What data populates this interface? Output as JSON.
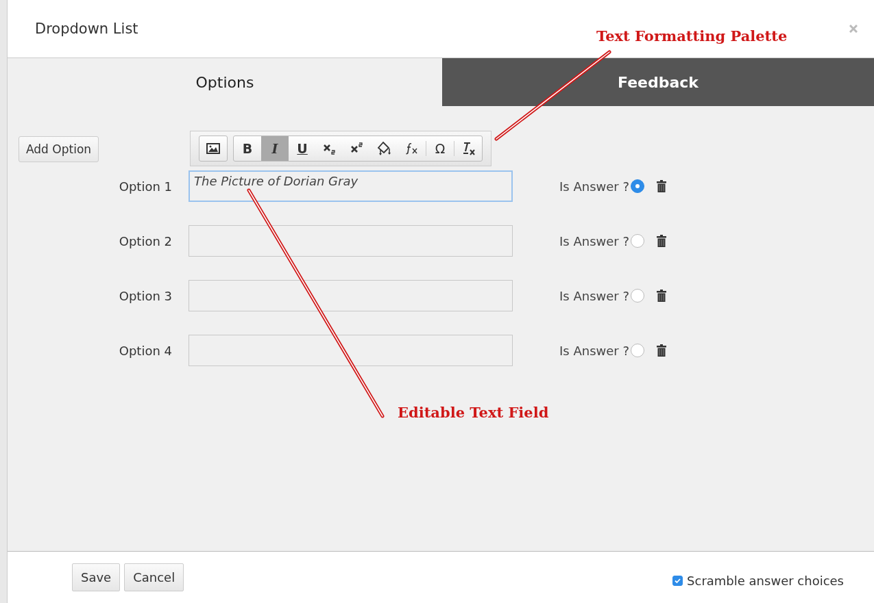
{
  "dialog": {
    "title": "Dropdown List"
  },
  "tabs": [
    {
      "label": "Options",
      "selected": true
    },
    {
      "label": "Feedback",
      "selected": false
    }
  ],
  "add_option_button": "Add Option",
  "toolbar": [
    {
      "kind": "image",
      "pressed": false
    },
    {
      "kind": "bold",
      "label": "B",
      "pressed": false
    },
    {
      "kind": "italic",
      "label": "I",
      "pressed": true
    },
    {
      "kind": "underline",
      "label": "U",
      "pressed": false
    },
    {
      "kind": "subscript",
      "pressed": false
    },
    {
      "kind": "superscript",
      "pressed": false
    },
    {
      "kind": "fill",
      "pressed": false
    },
    {
      "kind": "formula",
      "pressed": false
    },
    {
      "kind": "symbol",
      "label": "Ω",
      "pressed": false
    },
    {
      "kind": "clear",
      "pressed": false
    }
  ],
  "options": [
    {
      "label": "Option 1",
      "value": "The Picture of Dorian Gray",
      "focused": true,
      "answer_label": "Is Answer ?",
      "is_answer": true
    },
    {
      "label": "Option 2",
      "focused": false,
      "answer_label": "Is Answer ?",
      "is_answer": false
    },
    {
      "label": "Option 3",
      "focused": false,
      "answer_label": "Is Answer ?",
      "is_answer": false
    },
    {
      "label": "Option 4",
      "focused": false,
      "answer_label": "Is Answer ?",
      "is_answer": false
    }
  ],
  "footer": {
    "buttons": [
      "Save",
      "Cancel"
    ],
    "scramble": {
      "label": "Scramble answer choices",
      "checked": true
    }
  },
  "annotations": [
    {
      "text": "Text Formatting Palette"
    },
    {
      "text": "Editable Text Field"
    }
  ]
}
